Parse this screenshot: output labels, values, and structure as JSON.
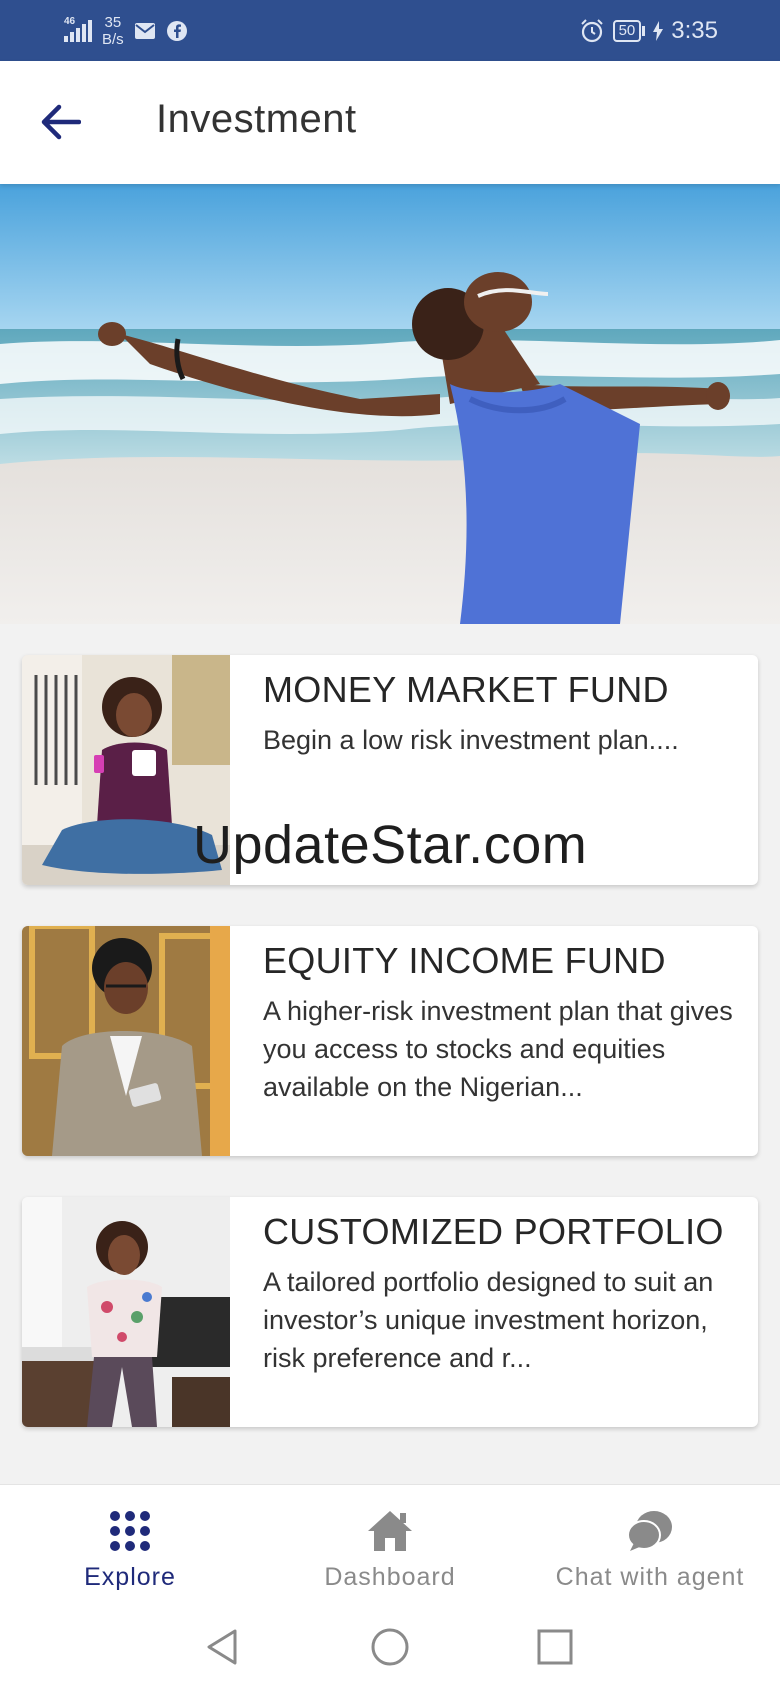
{
  "status_bar": {
    "network": "46",
    "speed_value": "35",
    "speed_unit": "B/s",
    "battery": "50",
    "time": "3:35"
  },
  "header": {
    "title": "Investment",
    "back_icon": "arrow-left-icon"
  },
  "funds": [
    {
      "title": "MONEY MARKET FUND",
      "description": "Begin a low risk investment plan...."
    },
    {
      "title": "EQUITY INCOME FUND",
      "description": "A higher-risk investment plan that gives you access to stocks and equities available on the Nigerian..."
    },
    {
      "title": "CUSTOMIZED PORTFOLIO",
      "description": "A tailored portfolio designed to suit an investor’s unique investment horizon, risk preference and r..."
    }
  ],
  "watermark": "UpdateStar.com",
  "bottom_nav": [
    {
      "label": "Explore",
      "icon": "grid-dots-icon",
      "active": true
    },
    {
      "label": "Dashboard",
      "icon": "home-icon",
      "active": false
    },
    {
      "label": "Chat with agent",
      "icon": "chat-bubbles-icon",
      "active": false
    }
  ],
  "colors": {
    "status_bar": "#2f4f8f",
    "accent": "#1f2a7a",
    "inactive": "#8a8a8a"
  }
}
